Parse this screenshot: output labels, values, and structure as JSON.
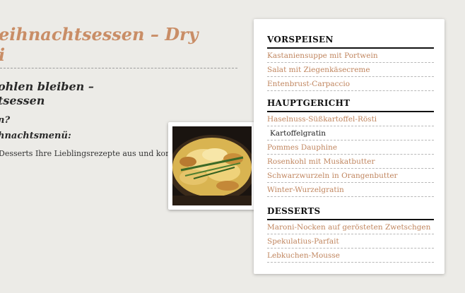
{
  "article": {
    "title_line1": "eihnachtsessen – Dry",
    "title_line2": "i",
    "subhead_line1": "ohlen bleiben –",
    "subhead_line2": "tsessen",
    "question1": "n?",
    "question2": "hnachtsmenü:",
    "body_text": "Desserts Ihre Lieblingsrezepte aus und kombinier"
  },
  "menu": {
    "sections": [
      {
        "title": "VORSPEISEN",
        "items": [
          "Kastaniensuppe mit Portwein",
          "Salat mit Ziegenkäsecreme",
          "Entenbrust-Carpaccio"
        ]
      },
      {
        "title": "HAUPTGERICHT",
        "items": [
          "Haselnuss-Süßkartoffel-Rösti",
          "Kartoffelgratin",
          "Pommes Dauphine",
          "Rosenkohl mit Muskatbutter",
          "Schwarzwurzeln in Orangenbutter",
          "Winter-Wurzelgratin"
        ]
      },
      {
        "title": "DESSERTS",
        "items": [
          "Maroni-Nocken auf gerösteten Zwetschgen",
          "Spekulatius-Parfait",
          "Lebkuchen-Mousse"
        ]
      }
    ],
    "active_item": "Kartoffelgratin"
  },
  "colors": {
    "link": "#c0855e",
    "title_accent": "#c98d66",
    "text": "#2a2a2a"
  }
}
